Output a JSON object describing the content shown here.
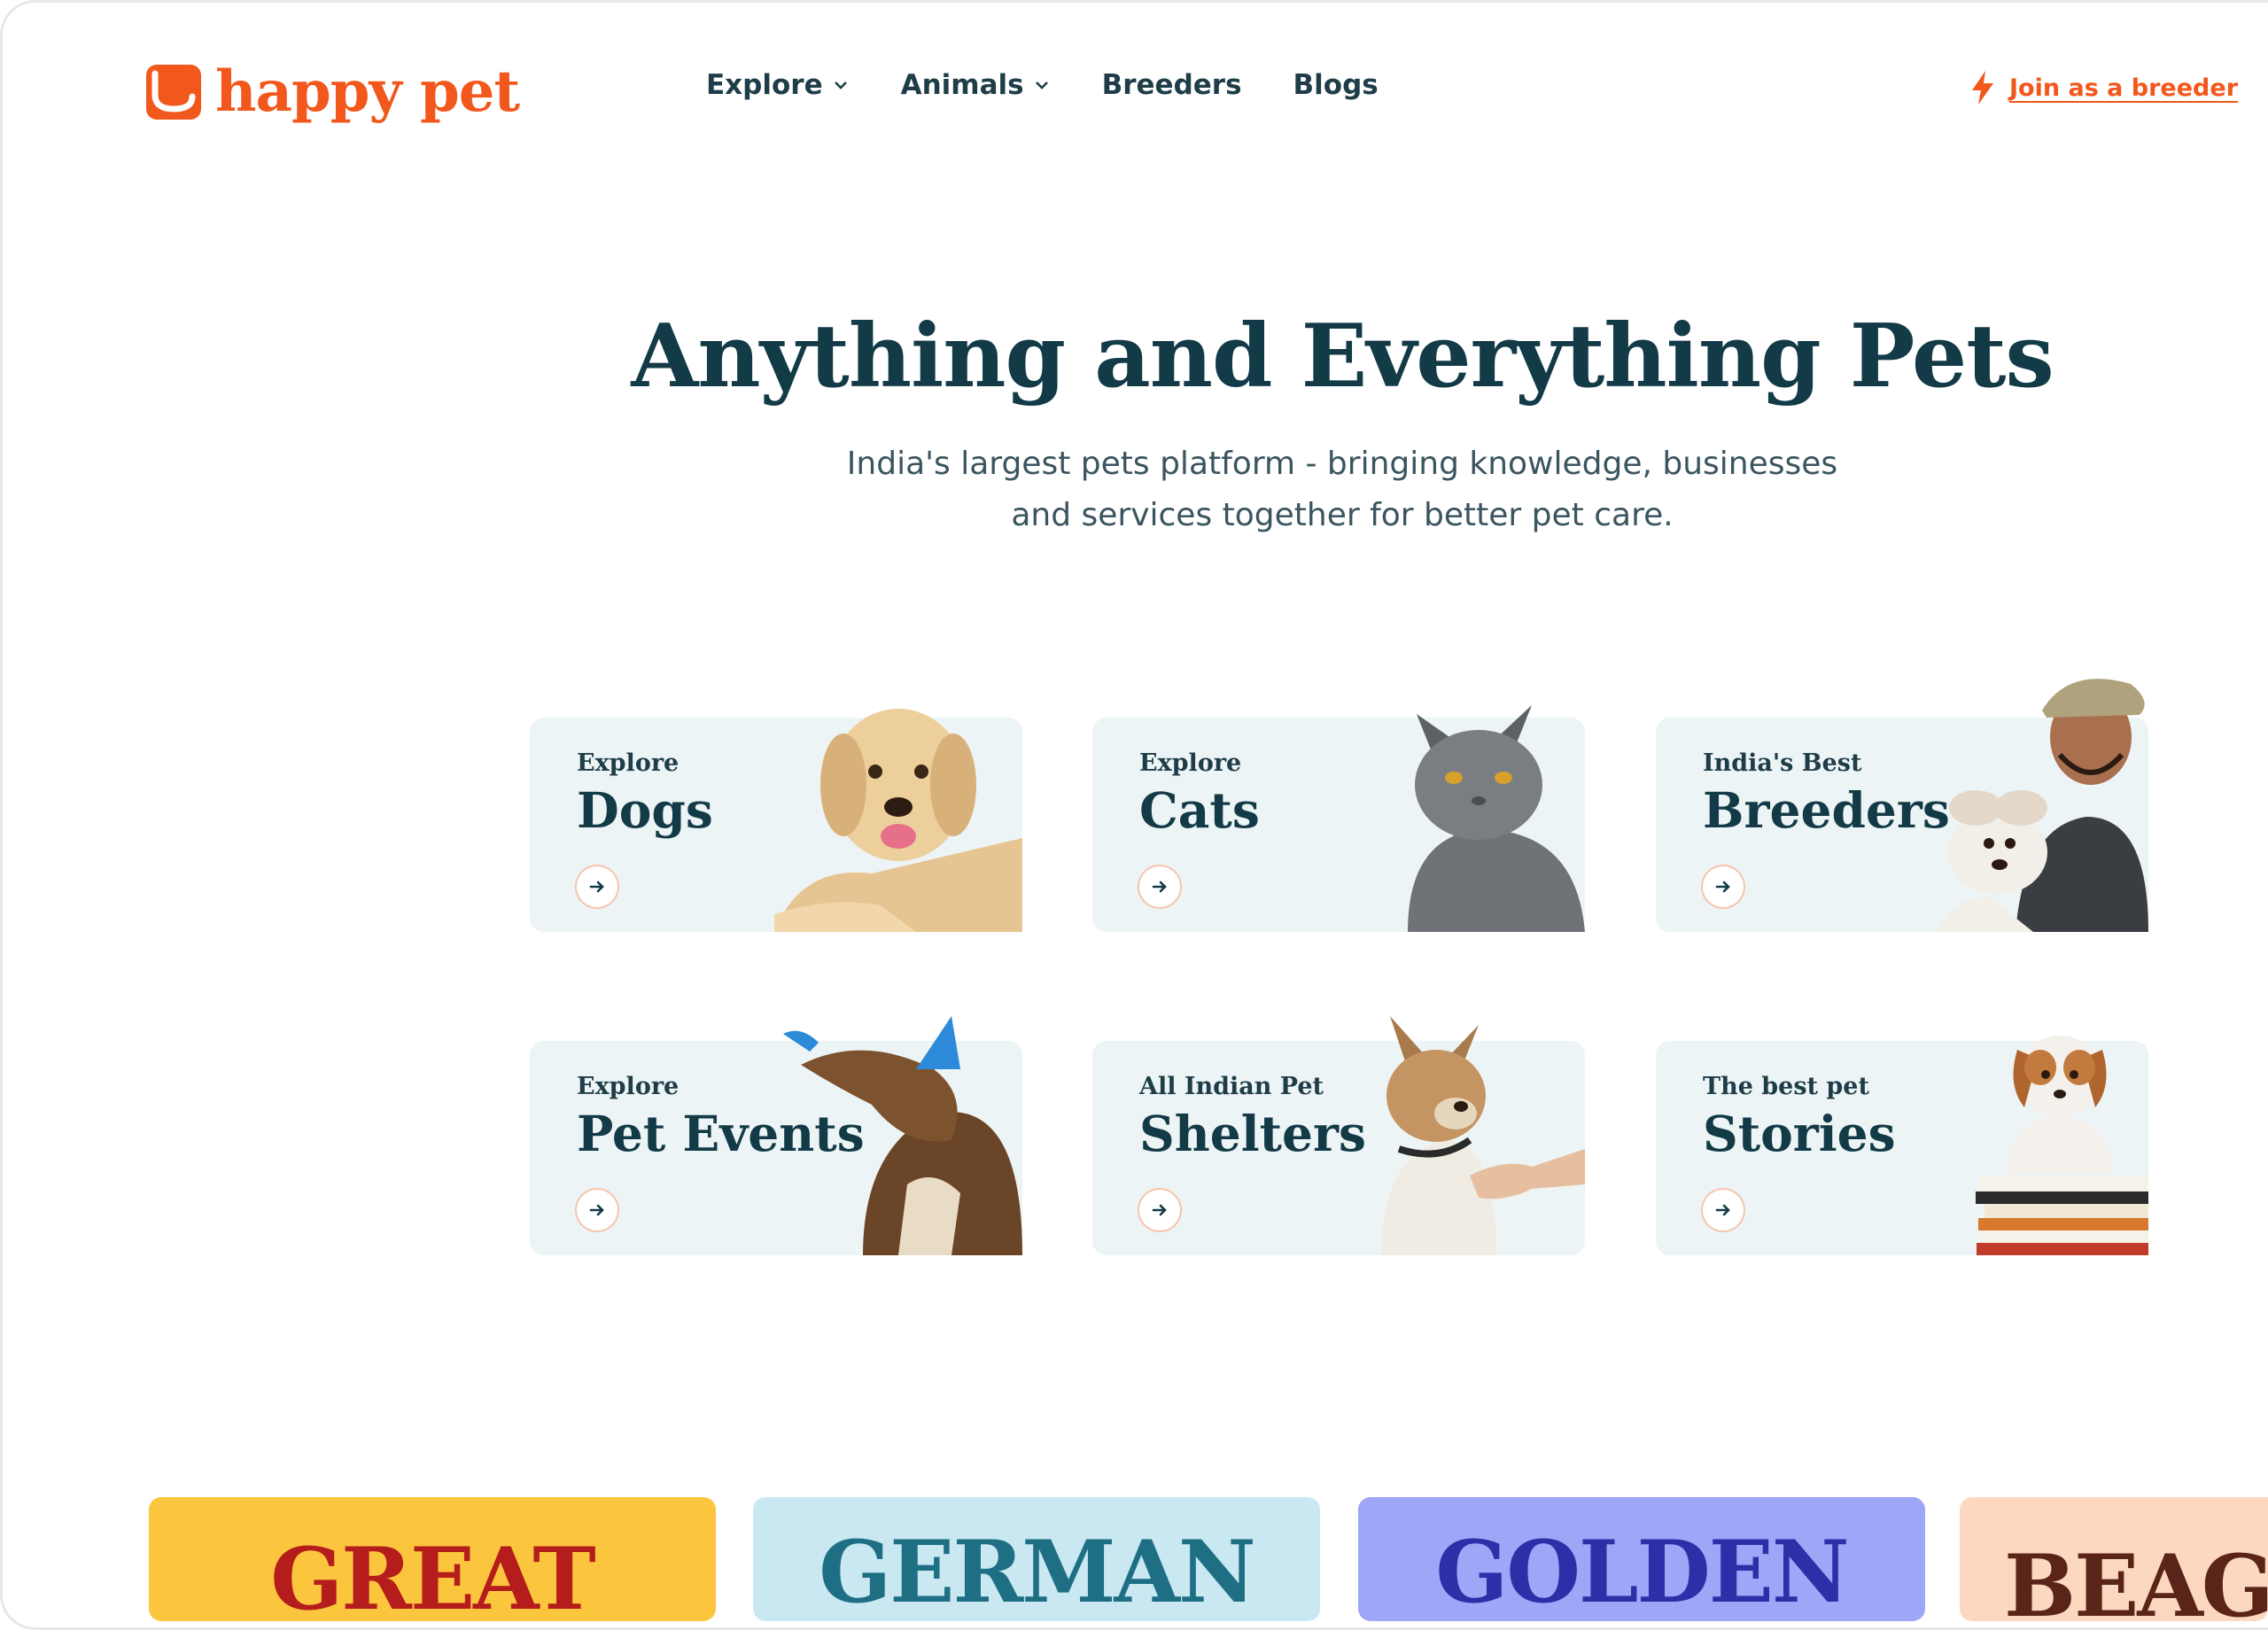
{
  "brand": {
    "name": "happy pet",
    "color": "#f2571c",
    "icon": "happy-pet-logo-icon"
  },
  "nav": {
    "items": [
      {
        "label": "Explore",
        "dropdown": true
      },
      {
        "label": "Animals",
        "dropdown": true
      },
      {
        "label": "Breeders",
        "dropdown": false
      },
      {
        "label": "Blogs",
        "dropdown": false
      }
    ],
    "cta": {
      "label": "Join as a breeder",
      "icon": "lightning-bolt-icon"
    }
  },
  "hero": {
    "title": "Anything and Everything Pets",
    "subtitle_line1": "India's largest pets platform - bringing knowledge, businesses",
    "subtitle_line2": "and services together for better pet care."
  },
  "cards": [
    {
      "eyebrow": "Explore",
      "title": "Dogs",
      "image": "golden-retriever-photo"
    },
    {
      "eyebrow": "Explore",
      "title": "Cats",
      "image": "grey-cat-photo"
    },
    {
      "eyebrow": "India's Best",
      "title": "Breeders",
      "image": "breeder-with-puppy-photo"
    },
    {
      "eyebrow": "Explore",
      "title": "Pet Events",
      "image": "dog-party-hat-photo"
    },
    {
      "eyebrow": "All Indian Pet",
      "title": "Shelters",
      "image": "dog-shaking-hand-photo"
    },
    {
      "eyebrow": "The best pet",
      "title": "Stories",
      "image": "puppy-on-books-photo"
    }
  ],
  "breed_tiles": [
    {
      "label": "GREAT",
      "bg": "#fcc53e",
      "fg": "#b51c1c"
    },
    {
      "label": "GERMAN",
      "bg": "#c9e8f2",
      "fg": "#1f6f84"
    },
    {
      "label": "GOLDEN",
      "bg": "#9ea6f7",
      "fg": "#2c2fa8"
    },
    {
      "label": "BEAG",
      "bg": "#fcd8c0",
      "fg": "#5a2418"
    }
  ],
  "colors": {
    "heading": "#133a47",
    "card_bg": "#edf4f5",
    "accent": "#f2571c"
  }
}
